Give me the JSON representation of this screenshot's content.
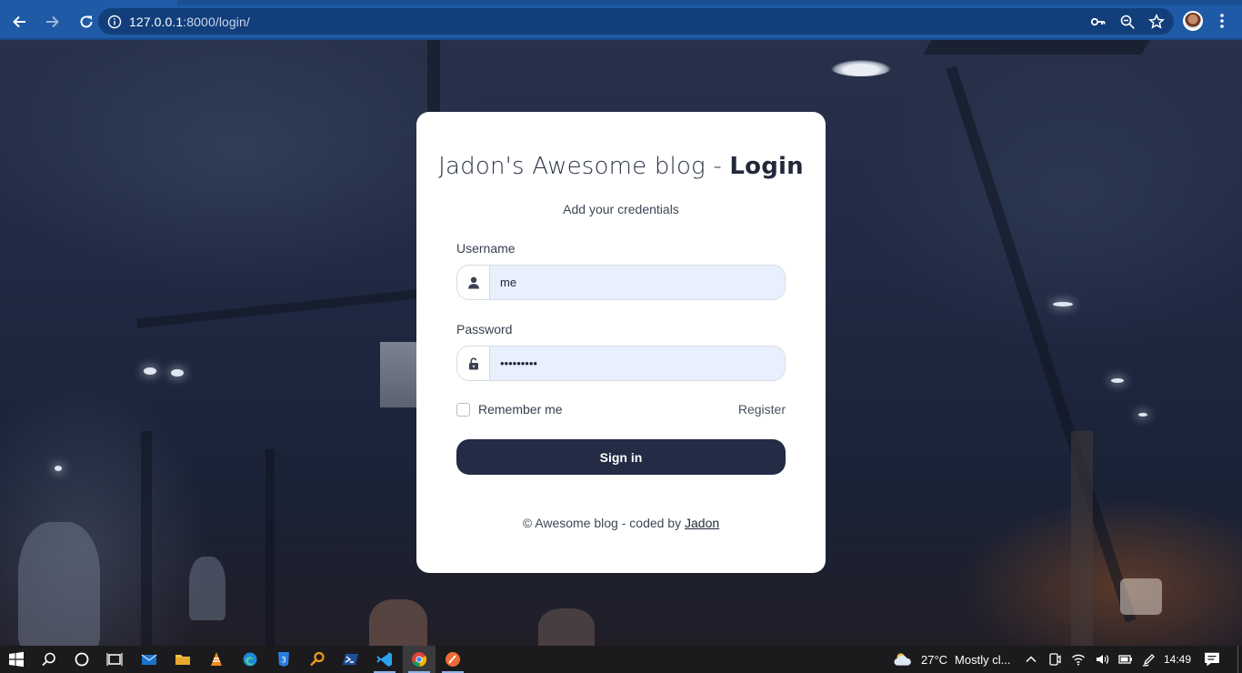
{
  "browser": {
    "url_host": "127.0.0.1",
    "url_path": ":8000/login/",
    "icons": [
      "back-icon",
      "forward-icon",
      "reload-icon",
      "site-info-icon",
      "key-icon",
      "zoom-icon",
      "bookmark-star-icon",
      "profile-avatar",
      "menu-dots-icon"
    ]
  },
  "card": {
    "title_light": "Jadon's Awesome blog - ",
    "title_bold": "Login",
    "subtitle": "Add your credentials",
    "username_label": "Username",
    "username_value": "me",
    "password_label": "Password",
    "password_value": "•••••••••",
    "remember_label": "Remember me",
    "register_link": "Register",
    "signin_button": "Sign in",
    "footer_prefix": "© Awesome blog - coded by ",
    "footer_link": "Jadon"
  },
  "taskbar": {
    "weather_temp": "27°C",
    "weather_desc": "Mostly cl...",
    "time": "14:49",
    "apps": [
      "start-icon",
      "search-icon",
      "cortana-icon",
      "task-view-icon",
      "mail-icon",
      "file-explorer-icon",
      "vlc-icon",
      "edge-icon",
      "app-3-icon",
      "key-app-icon",
      "powershell-icon",
      "vscode-icon",
      "chrome-icon",
      "postman-icon"
    ]
  },
  "colors": {
    "chrome_bar": "#1f5aa6",
    "omnibox": "#123f7b",
    "card_bg": "#ffffff",
    "input_fill": "#e8f0fe",
    "signin_button": "#232b45",
    "taskbar": "#1b1b1d"
  }
}
